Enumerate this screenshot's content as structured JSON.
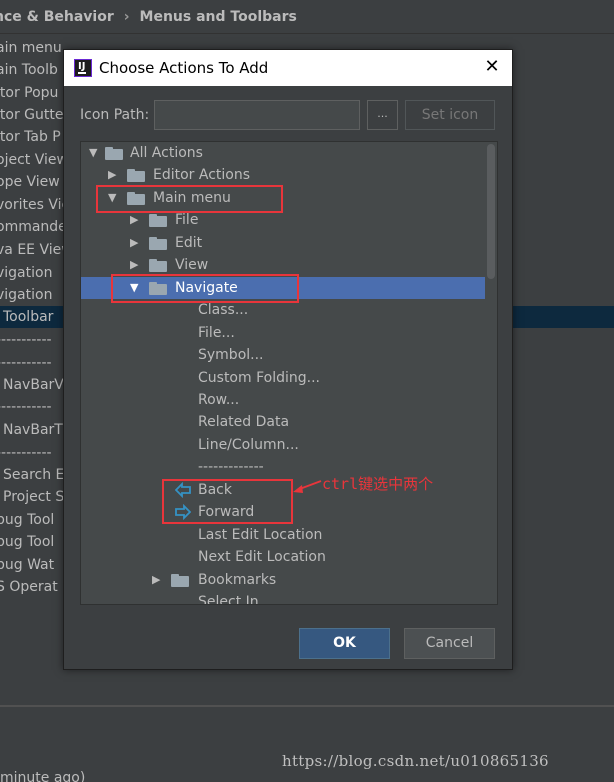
{
  "background": {
    "breadcrumb": [
      "nce & Behavior",
      "Menus and Toolbars"
    ],
    "breadcrumb_separator": "›",
    "list": [
      "ain menu",
      "ain Toolb",
      "itor Popu",
      "itor Gutte",
      "itor Tab P",
      "oject View",
      "ope View",
      "vorites Vie",
      "ommande",
      "va EE View",
      "vigation",
      "vigation",
      "Toolbar",
      "-----------",
      "-----------",
      "NavBarV",
      "-----------",
      "NavBarT",
      "-----------",
      "Search E",
      "Project S",
      "bug Tool",
      "bug Tool",
      "bug Wat",
      "S Operat"
    ],
    "selected_index": 12,
    "bottom_text": "minute ago)"
  },
  "dialog": {
    "title": "Choose Actions To Add",
    "close_glyph": "✕",
    "icon_path_label": "Icon Path:",
    "icon_path_value": "",
    "browse_label": "...",
    "set_icon_label": "Set icon",
    "ok_label": "OK",
    "cancel_label": "Cancel"
  },
  "tree": {
    "expanded_glyph": "▼",
    "collapsed_glyph": "▶",
    "selected_color": "#4b6eaf",
    "items": [
      {
        "label": "All Actions",
        "level": 0,
        "state": "expanded",
        "icon": "folder-icon"
      },
      {
        "label": "Editor Actions",
        "level": 1,
        "state": "collapsed",
        "icon": "editor-actions-icon"
      },
      {
        "label": "Main menu",
        "level": 1,
        "state": "expanded",
        "icon": "main-menu-icon"
      },
      {
        "label": "File",
        "level": 2,
        "state": "collapsed",
        "icon": "folder-icon"
      },
      {
        "label": "Edit",
        "level": 2,
        "state": "collapsed",
        "icon": "folder-icon"
      },
      {
        "label": "View",
        "level": 2,
        "state": "collapsed",
        "icon": "folder-icon"
      },
      {
        "label": "Navigate",
        "level": 2,
        "state": "expanded",
        "icon": "folder-icon",
        "selected": true
      },
      {
        "label": "Class...",
        "level": 3,
        "state": "leaf"
      },
      {
        "label": "File...",
        "level": 3,
        "state": "leaf"
      },
      {
        "label": "Symbol...",
        "level": 3,
        "state": "leaf"
      },
      {
        "label": "Custom Folding...",
        "level": 3,
        "state": "leaf"
      },
      {
        "label": "Row...",
        "level": 3,
        "state": "leaf"
      },
      {
        "label": "Related Data",
        "level": 3,
        "state": "leaf"
      },
      {
        "label": "Line/Column...",
        "level": 3,
        "state": "leaf"
      },
      {
        "label": "-------------",
        "level": 3,
        "state": "leaf"
      },
      {
        "label": "Back",
        "level": 3,
        "state": "leaf",
        "icon": "back-arrow-icon"
      },
      {
        "label": "Forward",
        "level": 3,
        "state": "leaf",
        "icon": "forward-arrow-icon"
      },
      {
        "label": "Last Edit Location",
        "level": 3,
        "state": "leaf"
      },
      {
        "label": "Next Edit Location",
        "level": 3,
        "state": "leaf"
      },
      {
        "label": "Bookmarks",
        "level": 3,
        "state": "collapsed",
        "icon": "folder-icon"
      },
      {
        "label": "Select In...",
        "level": 3,
        "state": "leaf"
      }
    ]
  },
  "annotation": {
    "text": "ctrl键选中两个",
    "color": "#e8353b"
  },
  "watermark": "https://blog.csdn.net/u010865136"
}
